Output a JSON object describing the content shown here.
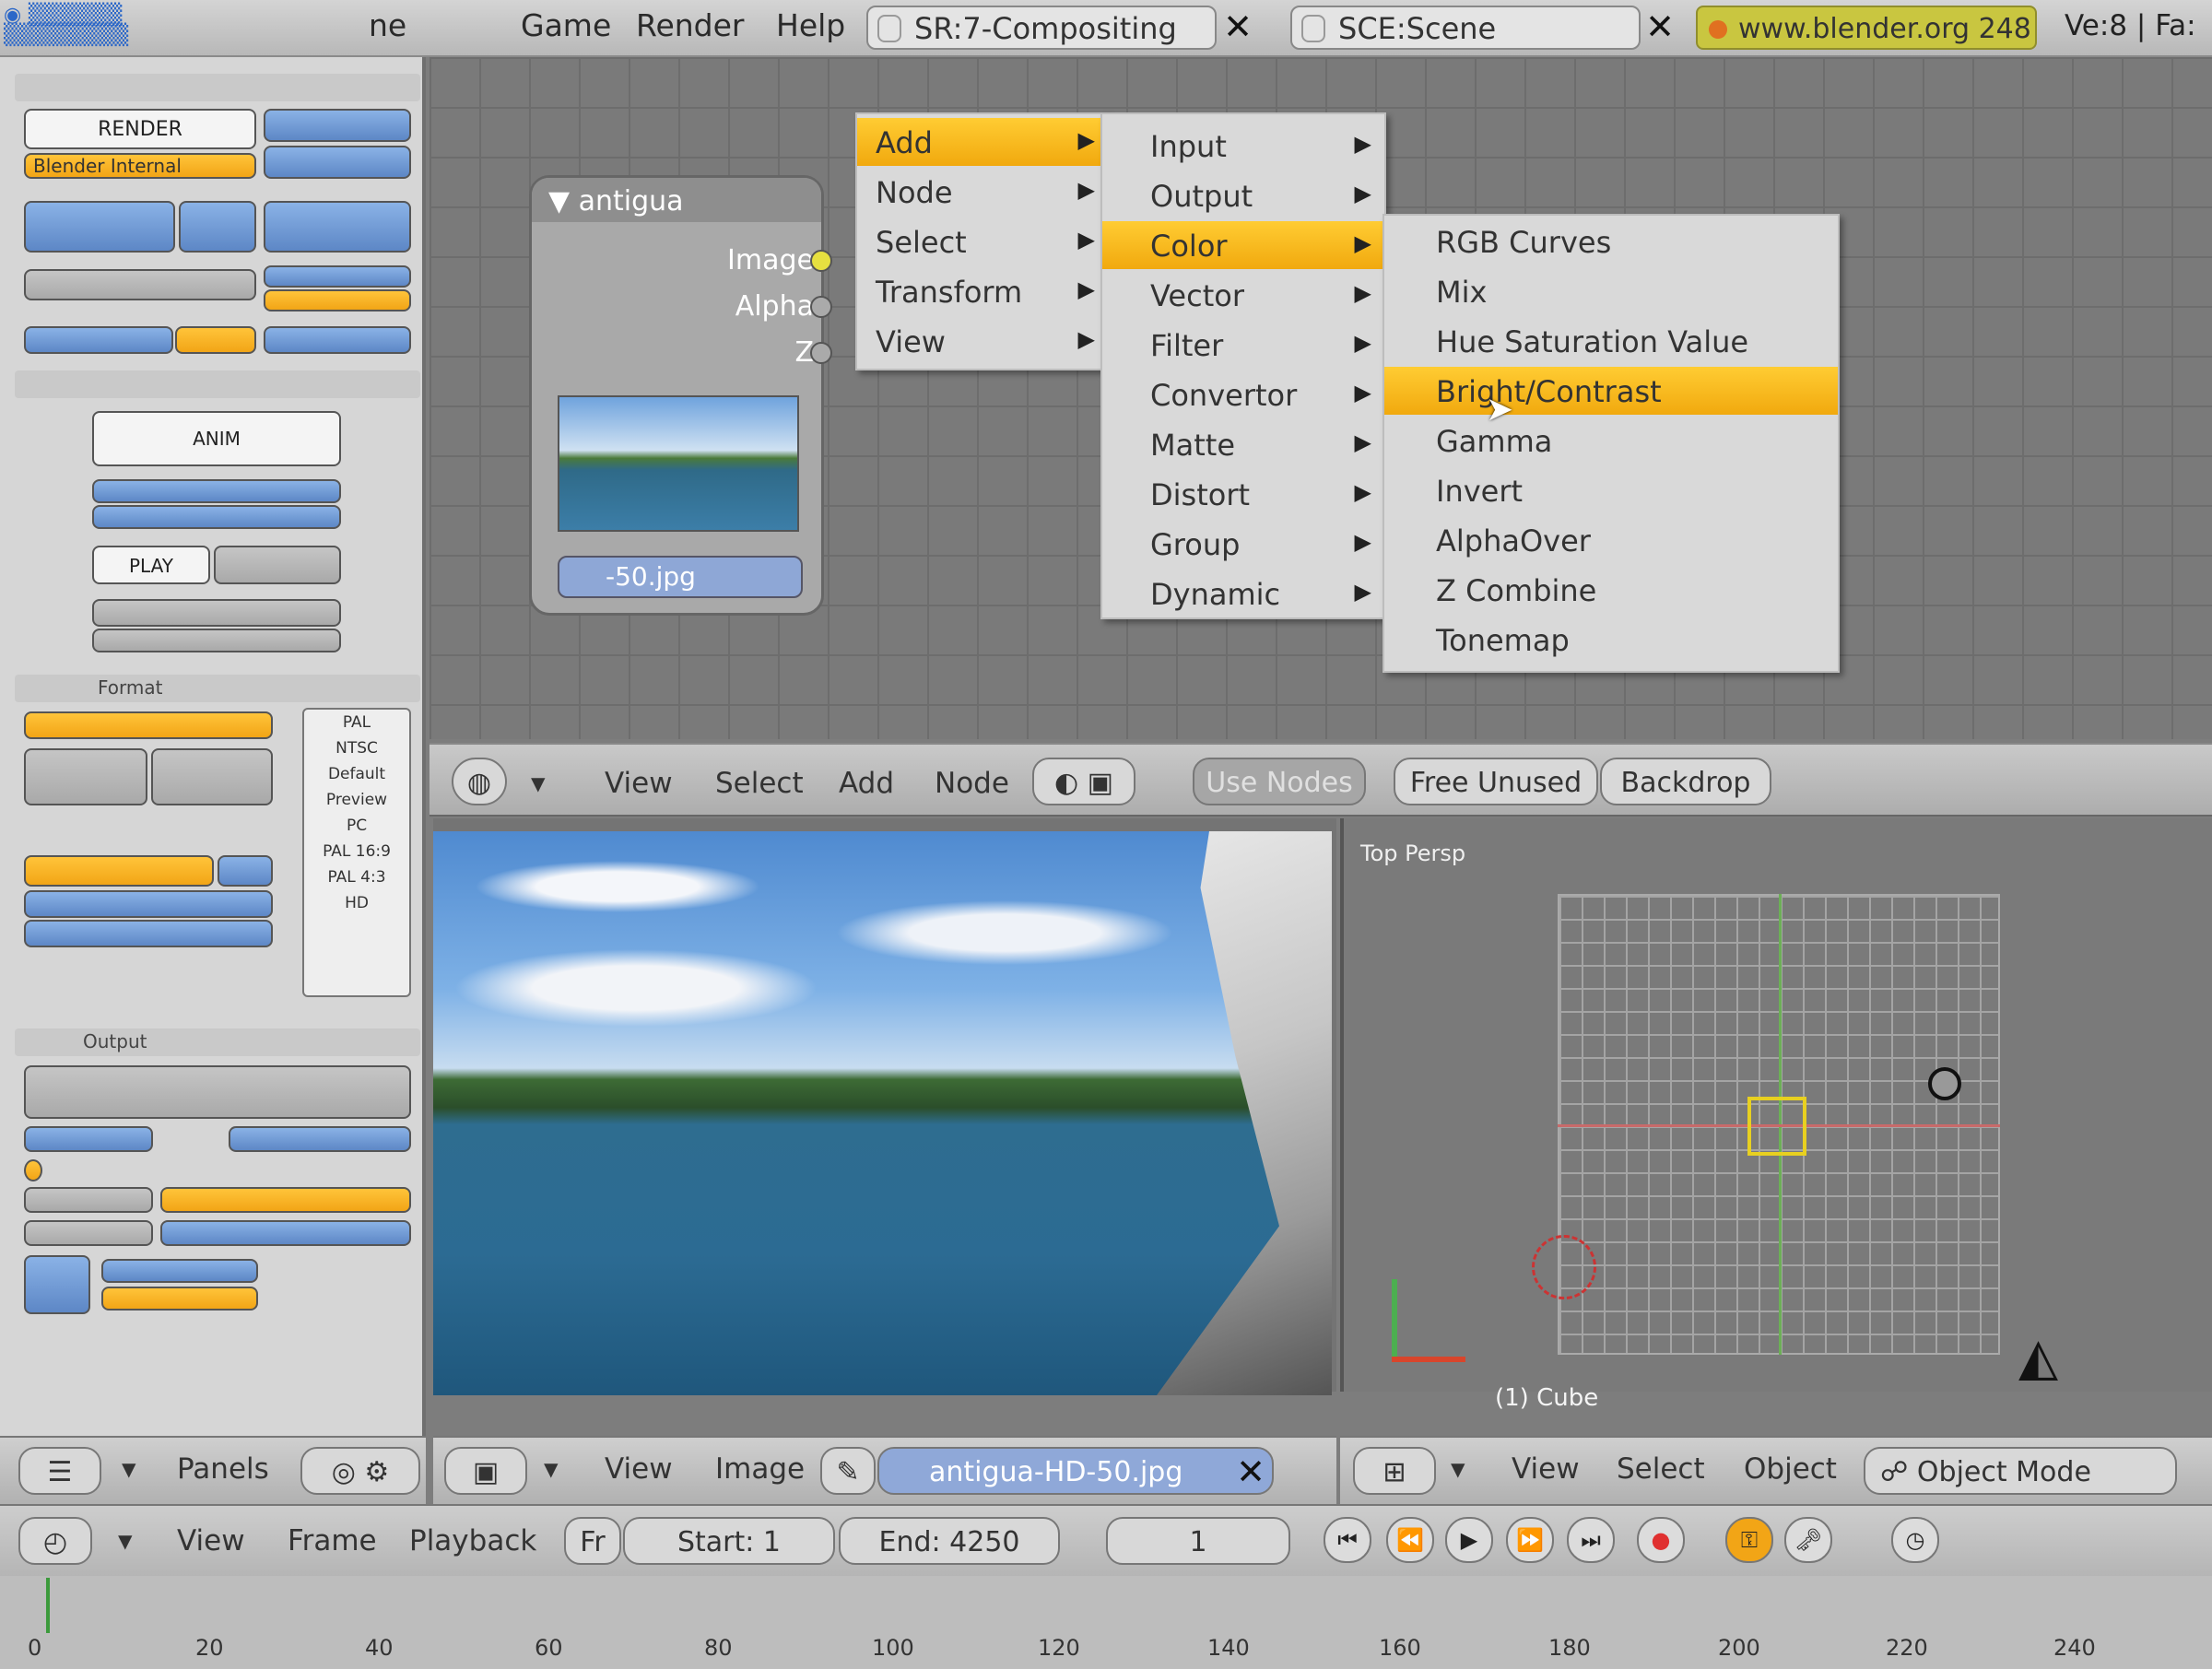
{
  "menubar": {
    "items": [
      "ne",
      "Game",
      "Render",
      "Help"
    ],
    "screen_field": "SR:7-Compositing",
    "scene_field": "SCE:Scene",
    "website": "www.blender.org 248",
    "version": "Ve:8 | Fa:"
  },
  "node": {
    "title": "antigua",
    "sockets": [
      "Image",
      "Alpha",
      "Z"
    ],
    "image_field": "-50.jpg"
  },
  "menu_add": {
    "items": [
      {
        "label": "Add",
        "highlight": true
      },
      {
        "label": "Node",
        "highlight": false
      },
      {
        "label": "Select",
        "highlight": false
      },
      {
        "label": "Transform",
        "highlight": false
      },
      {
        "label": "View",
        "highlight": false
      }
    ]
  },
  "menu_sub": {
    "items": [
      {
        "label": "Input",
        "highlight": false
      },
      {
        "label": "Output",
        "highlight": false
      },
      {
        "label": "Color",
        "highlight": true
      },
      {
        "label": "Vector",
        "highlight": false
      },
      {
        "label": "Filter",
        "highlight": false
      },
      {
        "label": "Convertor",
        "highlight": false
      },
      {
        "label": "Matte",
        "highlight": false
      },
      {
        "label": "Distort",
        "highlight": false
      },
      {
        "label": "Group",
        "highlight": false
      },
      {
        "label": "Dynamic",
        "highlight": false
      }
    ]
  },
  "menu_color": {
    "items": [
      {
        "label": "RGB Curves",
        "highlight": false
      },
      {
        "label": "Mix",
        "highlight": false
      },
      {
        "label": "Hue Saturation Value",
        "highlight": false
      },
      {
        "label": "Bright/Contrast",
        "highlight": true
      },
      {
        "label": "Gamma",
        "highlight": false
      },
      {
        "label": "Invert",
        "highlight": false
      },
      {
        "label": "AlphaOver",
        "highlight": false
      },
      {
        "label": "Z Combine",
        "highlight": false
      },
      {
        "label": "Tonemap",
        "highlight": false
      }
    ]
  },
  "nodebar": {
    "items": [
      "View",
      "Select",
      "Add",
      "Node"
    ],
    "use_nodes": "Use Nodes",
    "free_unused": "Free Unused",
    "backdrop": "Backdrop"
  },
  "buttons_panel": {
    "render_button": "RENDER",
    "render_engine": "Blender Internal",
    "anim_button": "ANIM",
    "play_button": "PLAY",
    "format_label": "Format",
    "output_label": "Output",
    "format_presets": [
      "PAL",
      "NTSC",
      "Default",
      "Preview",
      "PC",
      "PAL 16:9",
      "PAL 4:3",
      "HD"
    ]
  },
  "bottom_left_bar": {
    "panels": "Panels"
  },
  "image_bar": {
    "items": [
      "View",
      "Image"
    ],
    "image_name": "antigua-HD-50.jpg"
  },
  "view3d": {
    "label": "Top Persp",
    "object_label": "(1) Cube",
    "items": [
      "View",
      "Select",
      "Object"
    ],
    "mode": "Object Mode"
  },
  "timeline": {
    "items": [
      "View",
      "Frame",
      "Playback"
    ],
    "fr": "Fr",
    "start": "Start: 1",
    "end": "End: 4250",
    "current": "1",
    "ticks": [
      "0",
      "20",
      "40",
      "60",
      "80",
      "100",
      "120",
      "140",
      "160",
      "180",
      "200",
      "220",
      "240"
    ]
  },
  "colors": {
    "highlight": "#f4b21a",
    "button_blue": "#6f96d2",
    "background": "#7a7a7a"
  }
}
